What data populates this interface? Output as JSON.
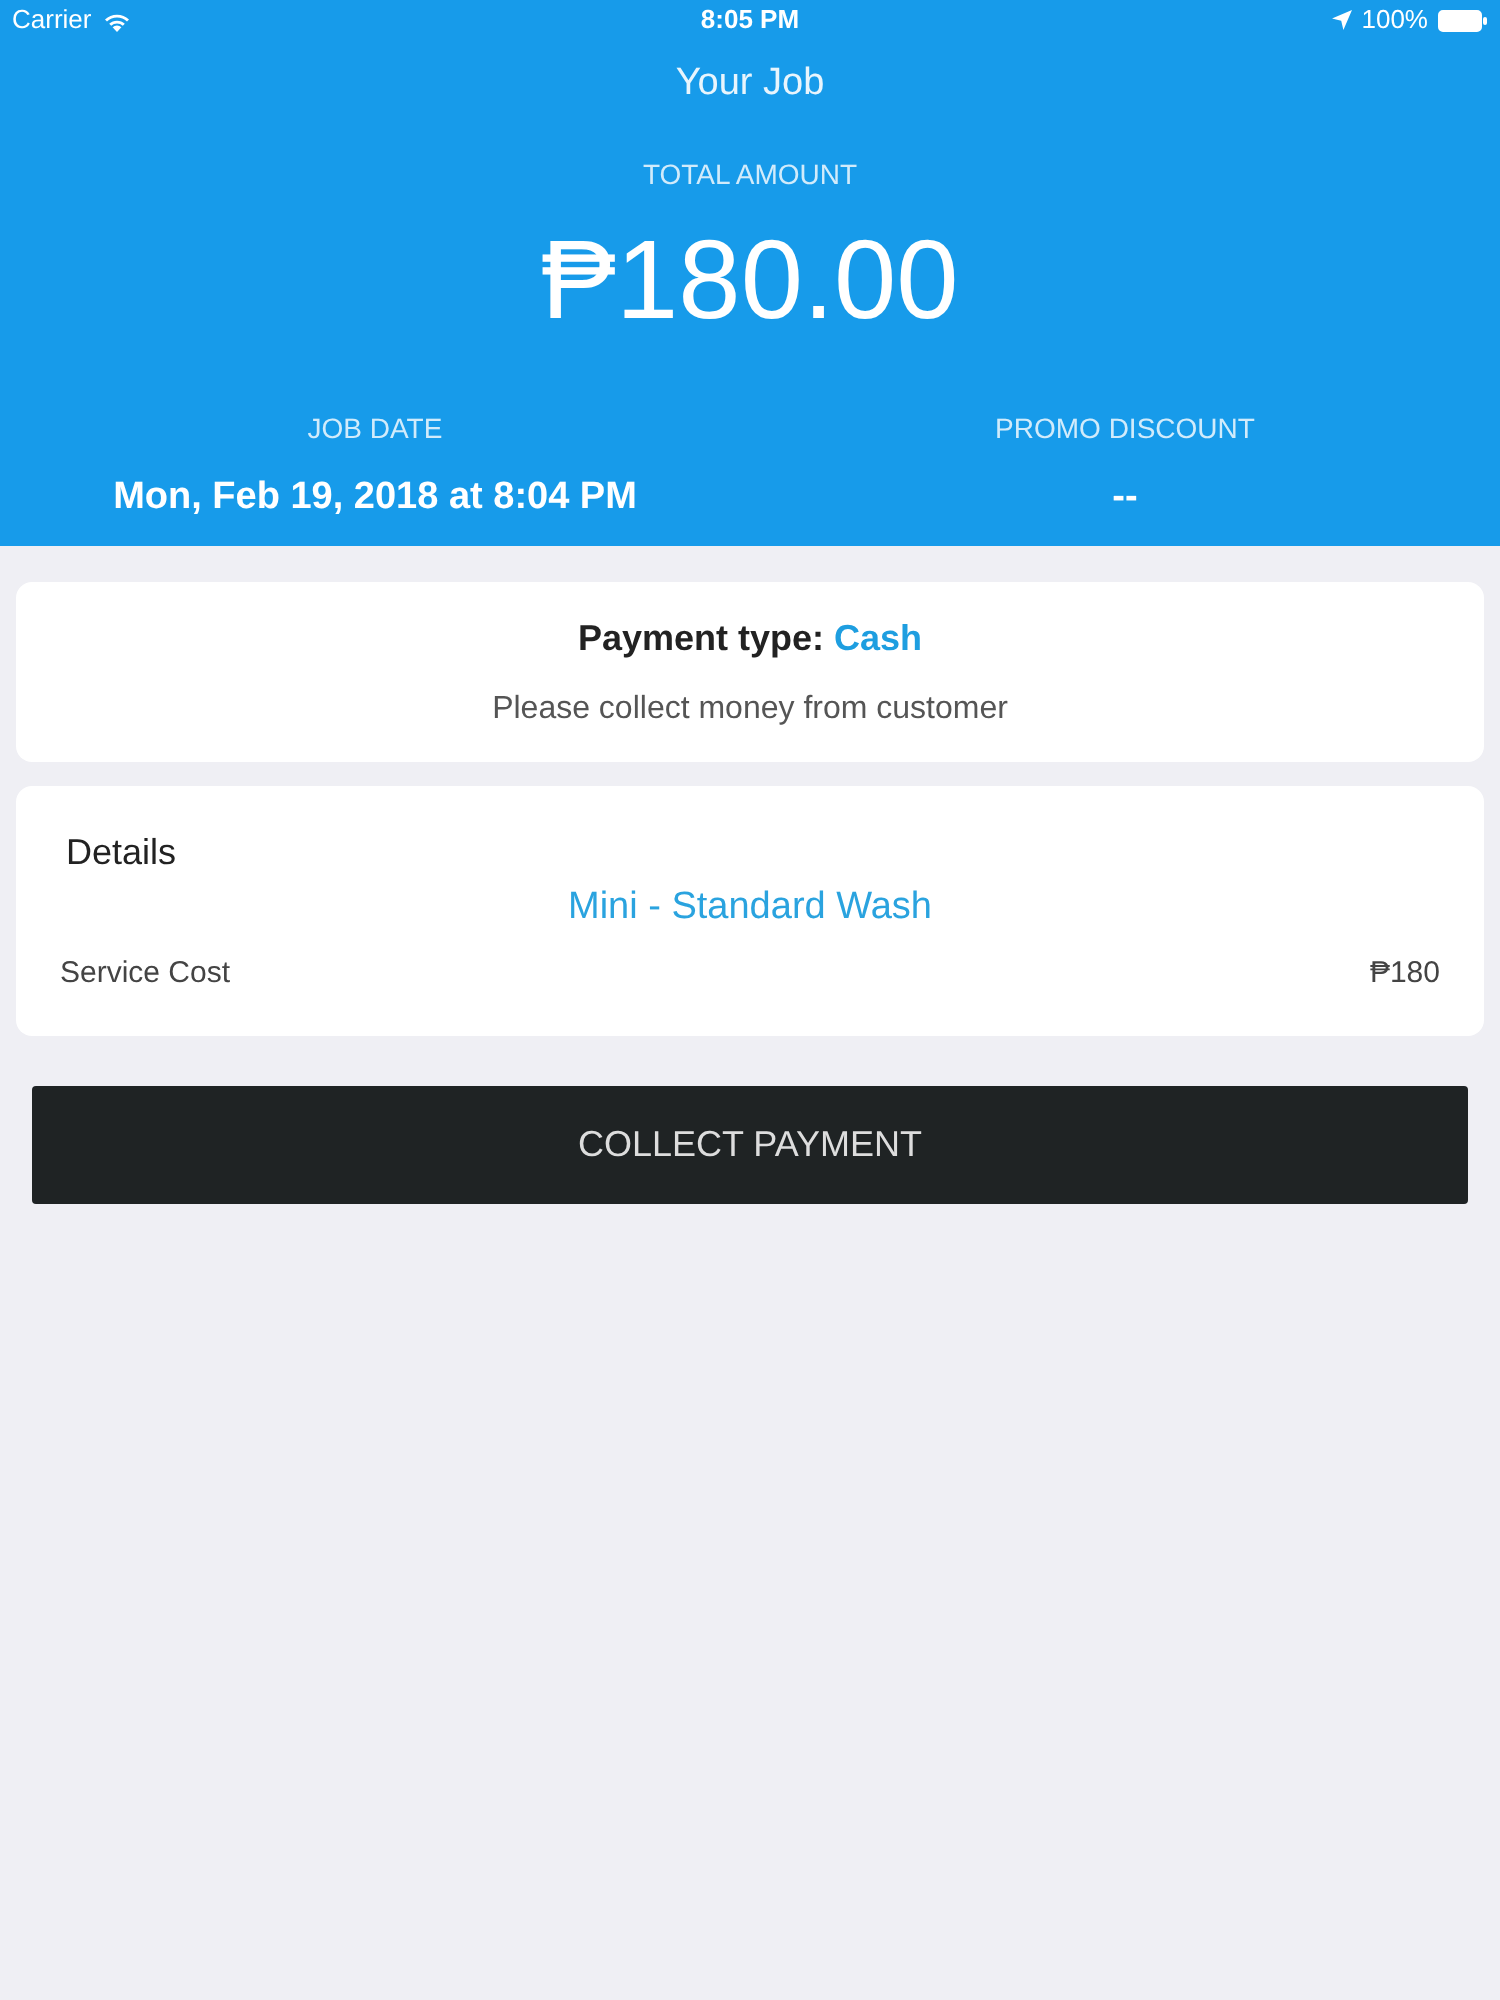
{
  "status_bar": {
    "carrier": "Carrier",
    "time": "8:05 PM",
    "battery": "100%"
  },
  "header": {
    "title": "Your Job",
    "total_label": "TOTAL AMOUNT",
    "total_amount": "₱180.00",
    "stats": [
      {
        "label": "JOB DATE",
        "value": "Mon, Feb 19, 2018 at 8:04 PM"
      },
      {
        "label": "PROMO DISCOUNT",
        "value": "--"
      }
    ]
  },
  "payment_card": {
    "label": "Payment type:",
    "value": "Cash",
    "note": "Please collect money from customer"
  },
  "details_card": {
    "title": "Details",
    "service_name": "Mini - Standard Wash",
    "rows": [
      {
        "label": "Service Cost",
        "value": "₱180"
      }
    ]
  },
  "primary_button": {
    "label": "COLLECT PAYMENT"
  }
}
